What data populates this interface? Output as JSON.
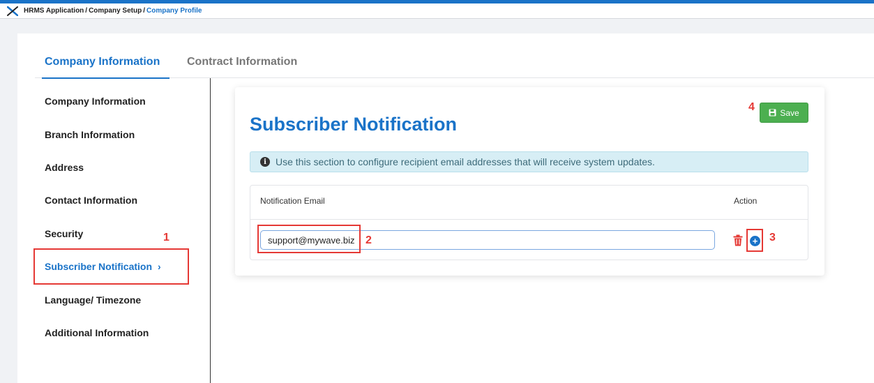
{
  "breadcrumb": {
    "app": "HRMS Application",
    "section": "Company Setup",
    "current": "Company Profile"
  },
  "tabs": [
    {
      "label": "Company Information",
      "active": true
    },
    {
      "label": "Contract Information",
      "active": false
    }
  ],
  "sidebar": {
    "items": [
      {
        "label": "Company Information"
      },
      {
        "label": "Branch Information"
      },
      {
        "label": "Address"
      },
      {
        "label": "Contact Information"
      },
      {
        "label": "Security"
      },
      {
        "label": "Subscriber Notification",
        "active": true,
        "chevron": "›"
      },
      {
        "label": "Language/ Timezone"
      },
      {
        "label": "Additional Information"
      }
    ]
  },
  "panel": {
    "title": "Subscriber Notification",
    "save_label": "Save",
    "info_text": "Use this section to configure recipient email addresses that will receive system updates.",
    "table": {
      "col_email": "Notification Email",
      "col_action": "Action",
      "rows": [
        {
          "email": "support@mywave.biz"
        }
      ]
    }
  },
  "annotations": [
    "1",
    "2",
    "3",
    "4"
  ],
  "colors": {
    "accent": "#1a73c8",
    "save": "#4caf50",
    "annotation": "#e53935",
    "info_bg": "#d7eef5"
  },
  "icons": [
    "app-logo-icon",
    "info-icon",
    "floppy-disk-icon",
    "trash-icon",
    "plus-circle-icon",
    "chevron-right-icon"
  ]
}
